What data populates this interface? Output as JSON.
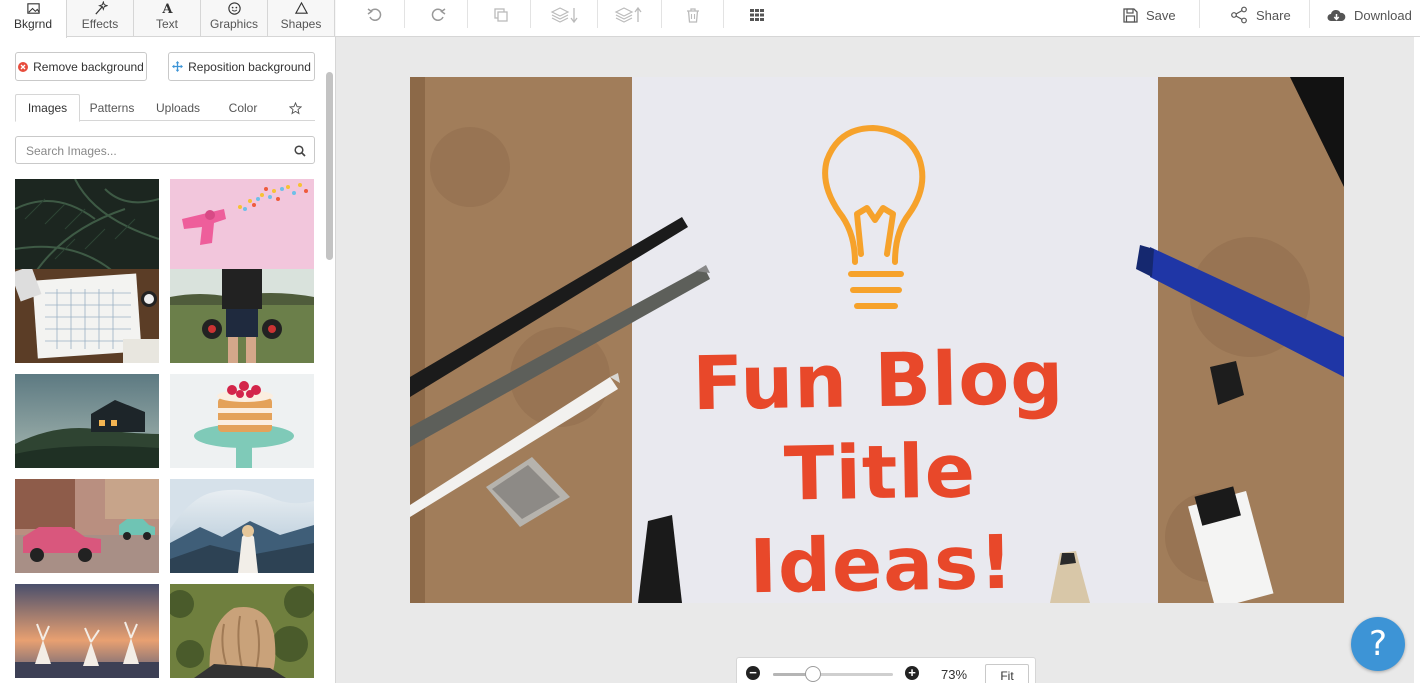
{
  "left_tabs": [
    {
      "label": "Bkgrnd",
      "icon": "image-icon"
    },
    {
      "label": "Effects",
      "icon": "magic-wand-icon"
    },
    {
      "label": "Text",
      "icon": "text-icon"
    },
    {
      "label": "Graphics",
      "icon": "smiley-icon"
    },
    {
      "label": "Shapes",
      "icon": "triangle-icon"
    }
  ],
  "background_actions": {
    "remove_label": "Remove background",
    "reposition_label": "Reposition background"
  },
  "image_tabs": [
    {
      "label": "Images"
    },
    {
      "label": "Patterns"
    },
    {
      "label": "Uploads"
    },
    {
      "label": "Color"
    }
  ],
  "search": {
    "placeholder": "Search Images..."
  },
  "thumbnails": [
    {
      "subject": "dark palm leaves"
    },
    {
      "subject": "pink toy gun with sprinkles"
    },
    {
      "subject": "calendar on desk"
    },
    {
      "subject": "man holding kettlebells"
    },
    {
      "subject": "house on hill at dusk"
    },
    {
      "subject": "layered cake with raspberries"
    },
    {
      "subject": "pink vintage car on street"
    },
    {
      "subject": "woman overlooking mountains"
    },
    {
      "subject": "dancers at sunset"
    },
    {
      "subject": "woman with curly hair"
    }
  ],
  "toolbar": {
    "save_label": "Save",
    "share_label": "Share",
    "download_label": "Download"
  },
  "canvas": {
    "title_line1": "Fun Blog",
    "title_line2": "Title Ideas!",
    "title_color": "#e8482a",
    "bulb_color": "#f6a22b"
  },
  "zoom": {
    "percent_label": "73%",
    "level": 0.33,
    "fit_label": "Fit"
  },
  "help": {
    "label": "?"
  },
  "colors": {
    "accent_blue": "#3d94d6",
    "remove_red": "#e74c3c",
    "move_blue": "#3d94d6"
  }
}
